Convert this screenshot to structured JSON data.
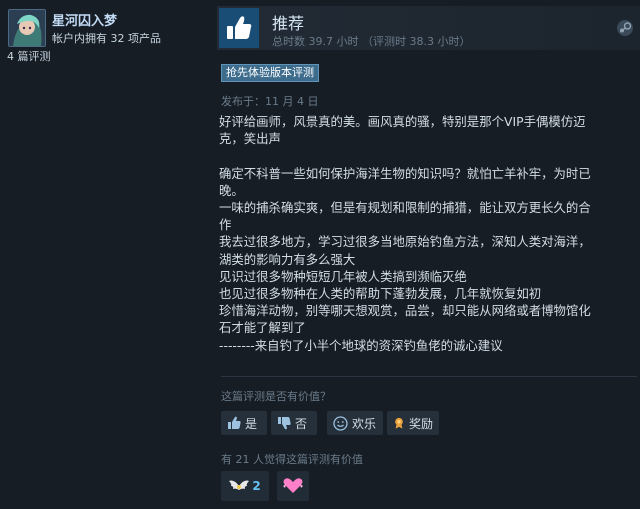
{
  "user": {
    "name": "星河囚入梦",
    "owned_products": "帐户内拥有 32 项产品",
    "review_count": "4 篇评测"
  },
  "review": {
    "verdict": "推荐",
    "hours": "总时数 39.7 小时  （评测时 38.3 小时）",
    "early_access_badge": "抢先体验版本评测",
    "posted": "发布于：11 月 4 日",
    "lines": [
      "好评给画师，风景真的美。画风真的骚，特别是那个VIP手偶模仿迈",
      "克，笑出声",
      "",
      "确定不科普一些如何保护海洋生物的知识吗？就怕亡羊补牢，为时已",
      "晚。",
      "一味的捕杀确实爽，但是有规划和限制的捕猎，能让双方更长久的合",
      "作",
      "我去过很多地方，学习过很多当地原始钓鱼方法，深知人类对海洋，",
      "湖类的影响力有多么强大",
      "见识过很多物种短短几年被人类搞到濒临灭绝",
      "也见过很多物种在人类的帮助下蓬勃发展，几年就恢复如初",
      "珍惜海洋动物，别等哪天想观赏，品尝，却只能从网络或者博物馆化",
      "石才能了解到了",
      "--------来自钓了小半个地球的资深钓鱼佬的诚心建议"
    ]
  },
  "feedback": {
    "question": "这篇评测是否有价值？",
    "yes_label": "是",
    "no_label": "否",
    "funny_label": "欢乐",
    "award_label": "奖励",
    "found_helpful": "有 21 人觉得这篇评测有价值"
  },
  "awards": [
    {
      "icon": "wings-award-icon",
      "count": "2"
    },
    {
      "icon": "heart-award-icon",
      "count": ""
    }
  ],
  "colors": {
    "background": "#171d25",
    "accent": "#66c0f4",
    "thumb_bg": "#1a4d76",
    "badge_bg": "#3d6c8d"
  }
}
